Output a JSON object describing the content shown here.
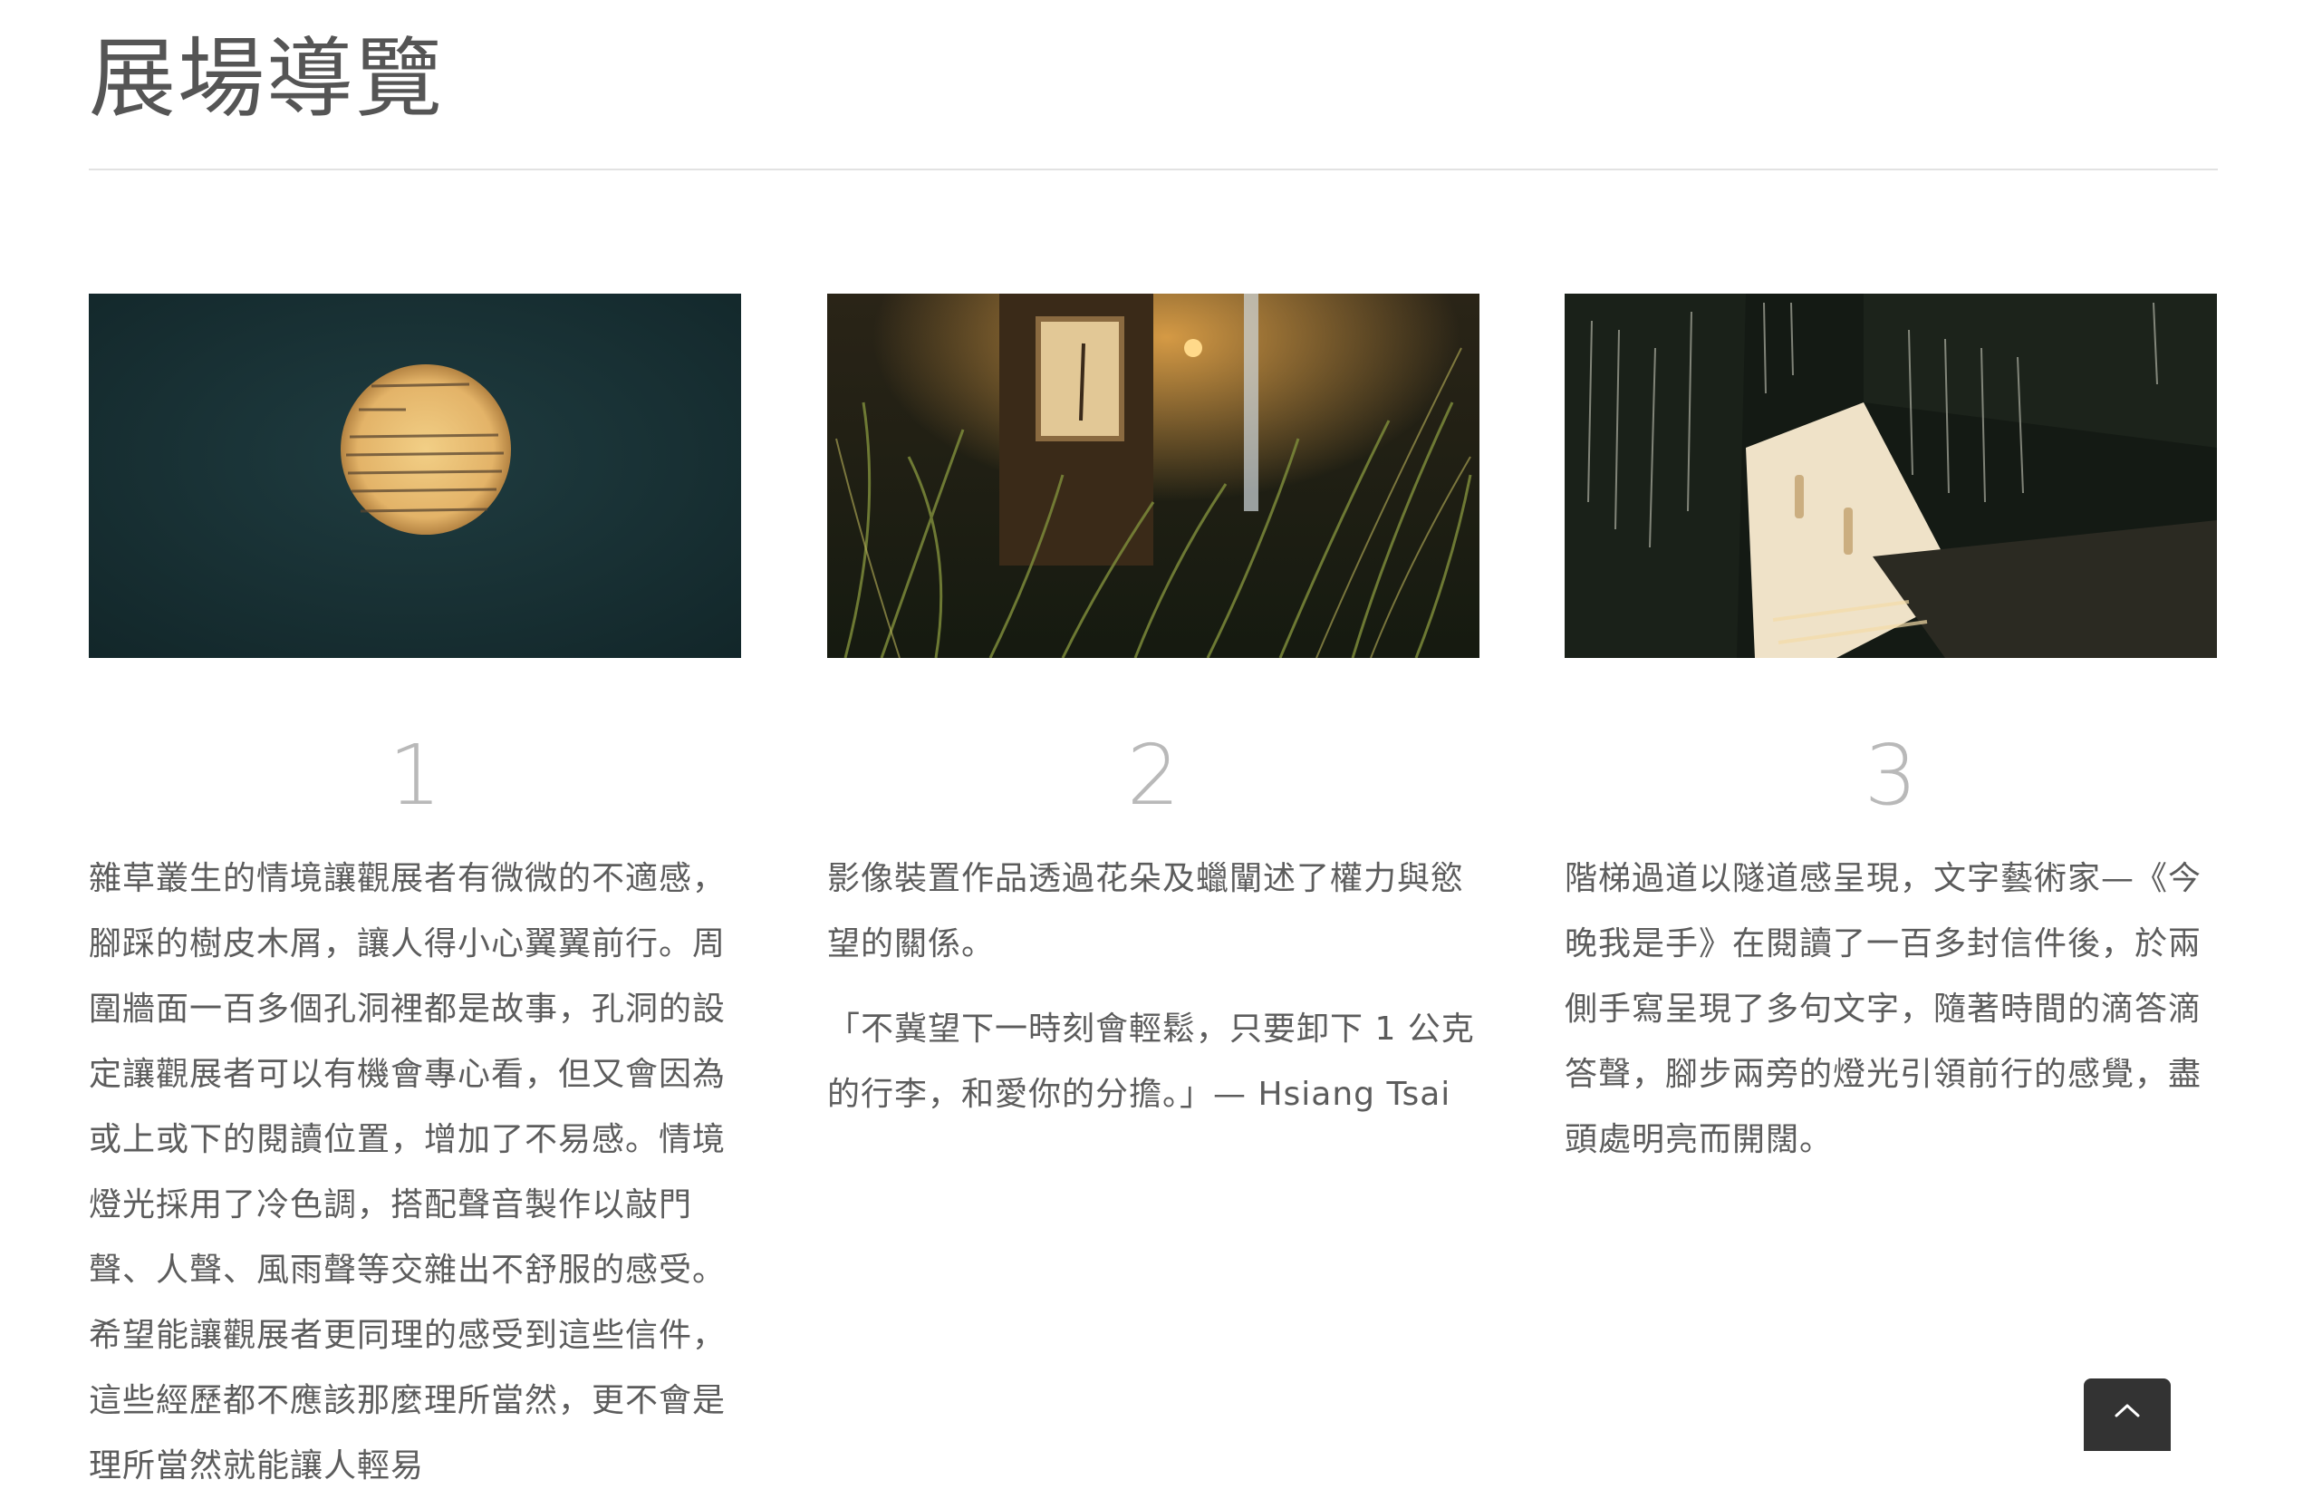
{
  "page": {
    "title": "展場導覽"
  },
  "sections": [
    {
      "number": "1",
      "image": "dark teal wall with a circular hole revealing a lit letter",
      "paragraphs": [
        "雜草叢生的情境讓觀展者有微微的不適感，腳踩的樹皮木屑，讓人得小心翼翼前行。周圍牆面一百多個孔洞裡都是故事，孔洞的設定讓觀展者可以有機會專心看，但又會因為或上或下的閱讀位置，增加了不易感。情境燈光採用了冷色調，搭配聲音製作以敲門聲、人聲、風雨聲等交雜出不舒服的感受。希望能讓觀展者更同理的感受到這些信件，這些經歷都不應該那麼理所當然，更不會是理所當然就能讓人輕易"
      ]
    },
    {
      "number": "2",
      "image": "framed artwork among tall grass under warm light",
      "paragraphs": [
        "影像裝置作品透過花朵及蠟闡述了權力與慾望的關係。",
        "「不冀望下一時刻會輕鬆，只要卸下 1 公克的行李，和愛你的分擔。」— Hsiang Tsai"
      ]
    },
    {
      "number": "3",
      "image": "staircase passage with handwritten text on dark walls",
      "paragraphs": [
        "階梯過道以隧道感呈現，文字藝術家—《今晚我是手》在閱讀了一百多封信件後，於兩側手寫呈現了多句文字，隨著時間的滴答滴答聲，腳步兩旁的燈光引領前行的感覺，盡頭處明亮而開闊。"
      ]
    }
  ],
  "controls": {
    "back_to_top_icon": "chevron-up-icon"
  },
  "colors": {
    "title": "#555555",
    "divider": "#e2e2e2",
    "number": "#b9b9b9",
    "body_text": "#5c5c5c",
    "back_to_top_bg": "#333333"
  }
}
